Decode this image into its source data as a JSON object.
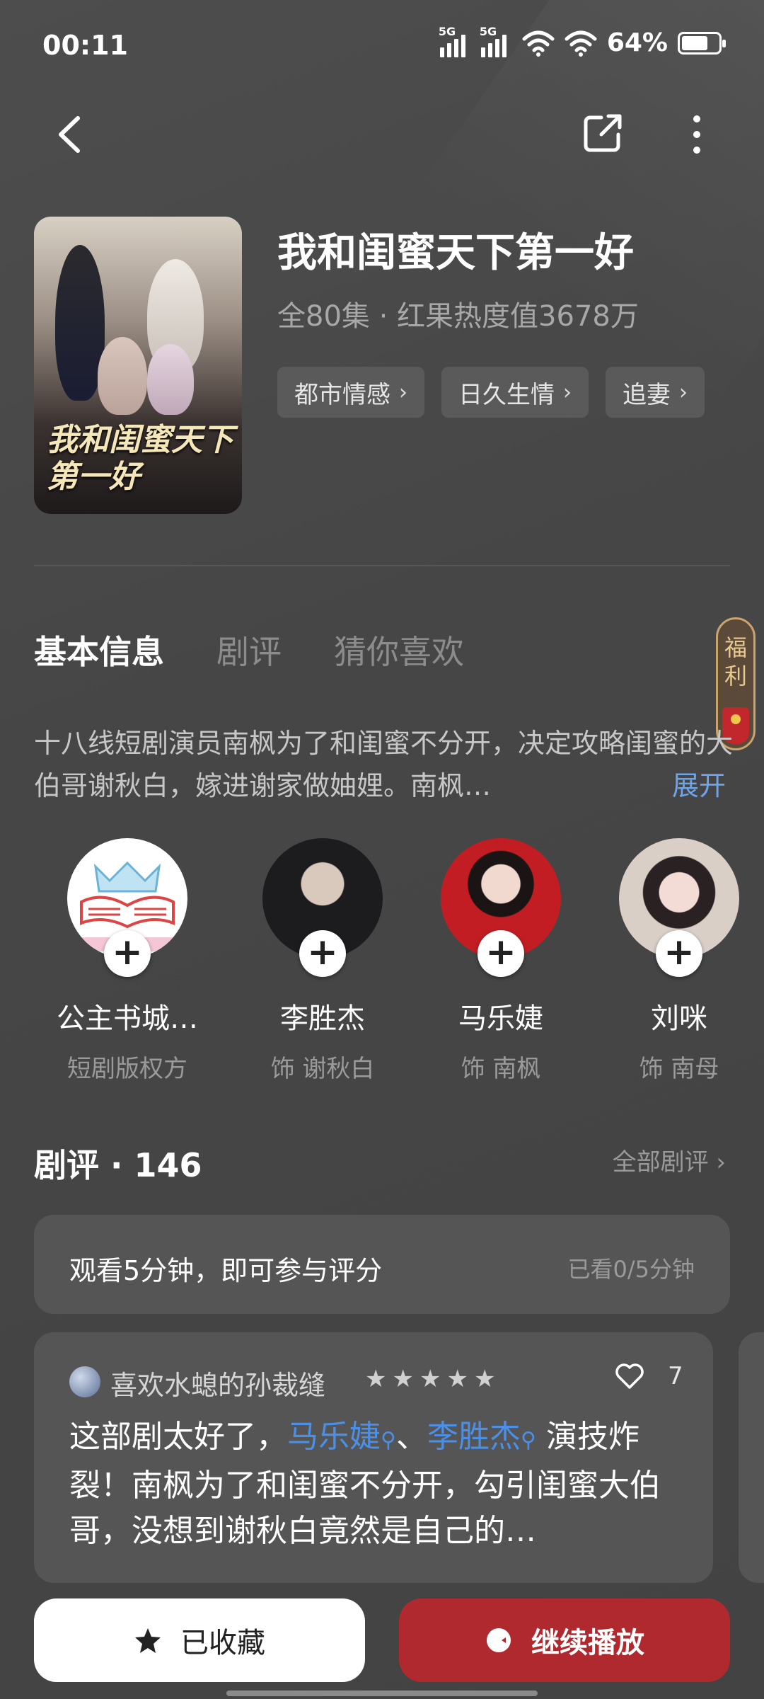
{
  "status_bar": {
    "time": "00:11",
    "network_1": "5G",
    "network_2": "5G",
    "battery": "64%"
  },
  "nav": {
    "back_icon": "chevron-left-icon",
    "share_icon": "share-icon",
    "more_icon": "more-vertical-icon"
  },
  "drama": {
    "title": "我和闺蜜天下第一好",
    "meta": "全80集 · 红果热度值3678万",
    "poster_title": "我和闺蜜天下第一好",
    "tags": [
      "都市情感",
      "日久生情",
      "追妻"
    ]
  },
  "tabs": [
    "基本信息",
    "剧评",
    "猜你喜欢"
  ],
  "welfare": {
    "label_line1": "福",
    "label_line2": "利"
  },
  "synopsis": {
    "text": "十八线短剧演员南枫为了和闺蜜不分开，决定攻略闺蜜的大伯哥谢秋白，嫁进谢家做妯娌。南枫…",
    "expand_label": "展开"
  },
  "cast": [
    {
      "name": "公主书城…",
      "role": "短剧版权方"
    },
    {
      "name": "李胜杰",
      "role": "饰 谢秋白"
    },
    {
      "name": "马乐婕",
      "role": "饰 南枫"
    },
    {
      "name": "刘咪",
      "role": "饰 南母"
    }
  ],
  "reviews": {
    "title": "剧评 · 146",
    "all_label": "全部剧评",
    "watch_prompt": "观看5分钟，即可参与评分",
    "watch_progress": "已看0/5分钟",
    "review": {
      "user": "喜欢水螅的孙裁缝",
      "rating": 5,
      "likes": "7",
      "text_part1": "这部剧太好了，",
      "link1": "马乐婕",
      "separator": "、",
      "link2": "李胜杰",
      "text_part2": " 演技炸裂！南枫为了和闺蜜不分开，勾引闺蜜大伯哥，没想到谢秋白竟然是自己的…"
    }
  },
  "actions": {
    "favorite_label": "已收藏",
    "play_label": "继续播放"
  },
  "colors": {
    "background": "#4a4a4a",
    "accent_red": "#b0292e",
    "link_blue": "#4b8fe6"
  }
}
